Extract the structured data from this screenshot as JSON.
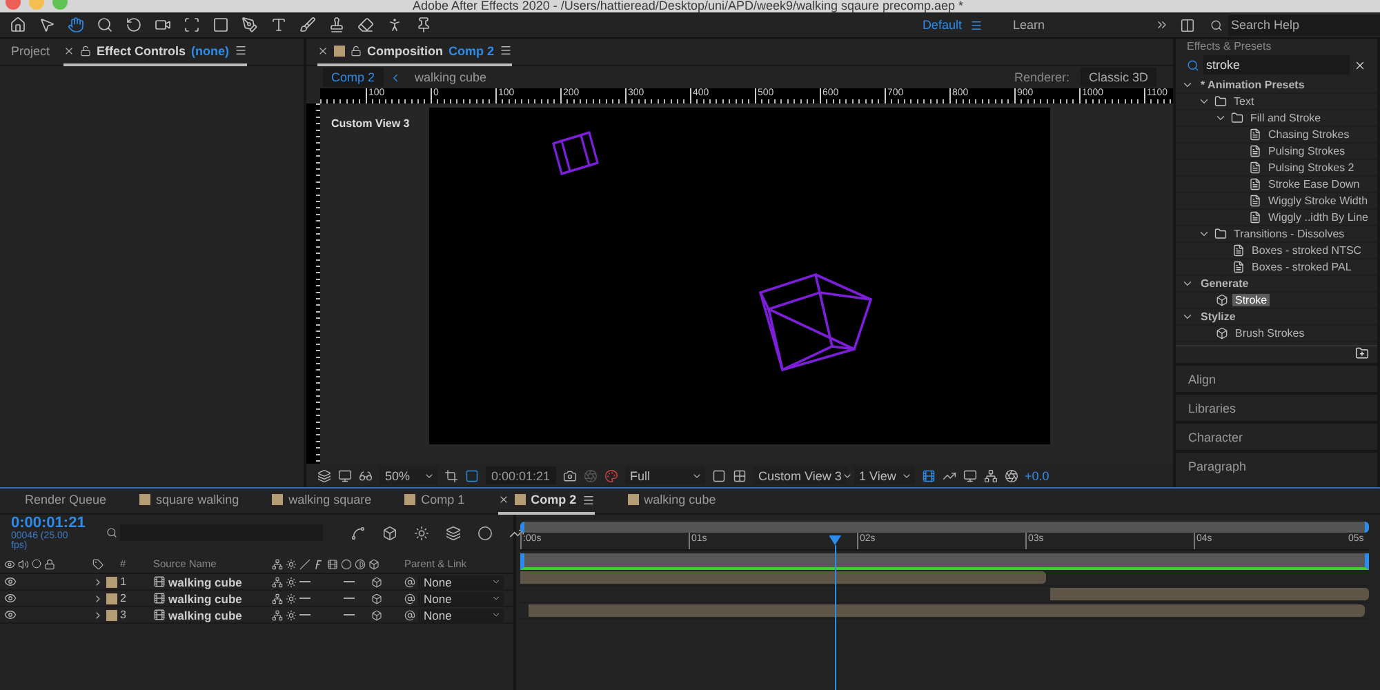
{
  "window": {
    "title": "Adobe After Effects 2020 - /Users/hattieread/Desktop/uni/APD/week9/walking sqaure precomp.aep *"
  },
  "toolbar": {
    "tools": [
      {
        "kind": "home",
        "selected": false
      },
      {
        "kind": "select",
        "selected": false
      },
      {
        "kind": "hand",
        "selected": true
      },
      {
        "kind": "zoom",
        "selected": false
      },
      {
        "kind": "rotate",
        "selected": false
      },
      {
        "kind": "camera",
        "selected": false
      },
      {
        "kind": "pan",
        "selected": false
      },
      {
        "kind": "shape",
        "selected": false
      },
      {
        "kind": "pen",
        "selected": false
      },
      {
        "kind": "type",
        "selected": false
      },
      {
        "kind": "brush",
        "selected": false
      },
      {
        "kind": "stamp",
        "selected": false
      },
      {
        "kind": "eraser",
        "selected": false
      },
      {
        "kind": "puppet",
        "selected": false
      },
      {
        "kind": "pin",
        "selected": false
      }
    ],
    "workspaces": [
      {
        "label": "Default",
        "selected": true
      },
      {
        "label": "Learn",
        "selected": false
      }
    ],
    "search_help": {
      "placeholder": "Search Help"
    }
  },
  "left_panel": {
    "tabs": [
      {
        "label": "Project",
        "selected": false
      },
      {
        "label": "Effect Controls",
        "detail": "(none)",
        "selected": true
      }
    ]
  },
  "composition": {
    "tab_label": "Composition",
    "tab_comp": "Comp 2",
    "breadcrumb": [
      {
        "label": "Comp 2",
        "selected": true
      },
      {
        "label": "walking cube",
        "selected": false
      }
    ],
    "renderer_label": "Renderer:",
    "renderer": "Classic 3D",
    "ruler": [
      "100",
      "0",
      "100",
      "200",
      "300",
      "400",
      "500",
      "600",
      "700",
      "800",
      "900",
      "1000",
      "1100"
    ],
    "view_label": "Custom View 3",
    "controls": {
      "zoom": "50%",
      "timecode": "0:00:01:21",
      "resolution": "Full",
      "view": "Custom View 3",
      "layout": "1 View",
      "exposure": "+0.0"
    }
  },
  "effects_presets": {
    "title": "Effects & Presets",
    "search": "stroke",
    "tree": [
      {
        "kind": "category",
        "label": "* Animation Presets",
        "expanded": true,
        "selected": false,
        "children": [
          {
            "kind": "folder",
            "label": "Text",
            "expanded": true,
            "selected": false,
            "children": [
              {
                "kind": "folder",
                "label": "Fill and Stroke",
                "expanded": true,
                "selected": false,
                "children": [
                  {
                    "kind": "preset",
                    "label": "Chasing Strokes",
                    "selected": false
                  },
                  {
                    "kind": "preset",
                    "label": "Pulsing Strokes",
                    "selected": false
                  },
                  {
                    "kind": "preset",
                    "label": "Pulsing Strokes 2",
                    "selected": false
                  },
                  {
                    "kind": "preset",
                    "label": "Stroke Ease Down",
                    "selected": false
                  },
                  {
                    "kind": "preset",
                    "label": "Wiggly Stroke Width",
                    "selected": false
                  },
                  {
                    "kind": "preset",
                    "label": "Wiggly ..idth By Line",
                    "selected": false
                  }
                ]
              }
            ]
          },
          {
            "kind": "folder",
            "label": "Transitions - Dissolves",
            "expanded": true,
            "selected": false,
            "children": [
              {
                "kind": "preset",
                "label": "Boxes - stroked NTSC",
                "selected": false
              },
              {
                "kind": "preset",
                "label": "Boxes - stroked PAL",
                "selected": false
              }
            ]
          }
        ]
      },
      {
        "kind": "category",
        "label": "Generate",
        "expanded": true,
        "selected": false,
        "children": [
          {
            "kind": "effect",
            "label": "Stroke",
            "selected": true
          }
        ]
      },
      {
        "kind": "category",
        "label": "Stylize",
        "expanded": true,
        "selected": false,
        "children": [
          {
            "kind": "effect",
            "label": "Brush Strokes",
            "selected": false
          }
        ]
      }
    ]
  },
  "collapsed_panels": [
    "Align",
    "Libraries",
    "Character",
    "Paragraph"
  ],
  "timeline": {
    "tabs": [
      {
        "kind": "queue",
        "label": "Render Queue",
        "selected": false
      },
      {
        "kind": "comp",
        "label": "square walking",
        "selected": false
      },
      {
        "kind": "comp",
        "label": "walking square",
        "selected": false
      },
      {
        "kind": "comp",
        "label": "Comp 1",
        "selected": false
      },
      {
        "kind": "comp",
        "label": "Comp 2",
        "selected": true
      },
      {
        "kind": "comp",
        "label": "walking cube",
        "selected": false
      }
    ],
    "timecode": "0:00:01:21",
    "frame": "00046 (25.00 fps)",
    "columns": {
      "number": "#",
      "source": "Source Name",
      "parent": "Parent & Link"
    },
    "layers": [
      {
        "number": "1",
        "name": "walking cube",
        "visible": true,
        "parent": "None"
      },
      {
        "number": "2",
        "name": "walking cube",
        "visible": true,
        "parent": "None"
      },
      {
        "number": "3",
        "name": "walking cube",
        "visible": true,
        "parent": "None"
      }
    ],
    "ruler": [
      ":00s",
      "01s",
      "02s",
      "03s",
      "04s",
      "05s"
    ],
    "playhead": {
      "level": 0.37
    }
  }
}
